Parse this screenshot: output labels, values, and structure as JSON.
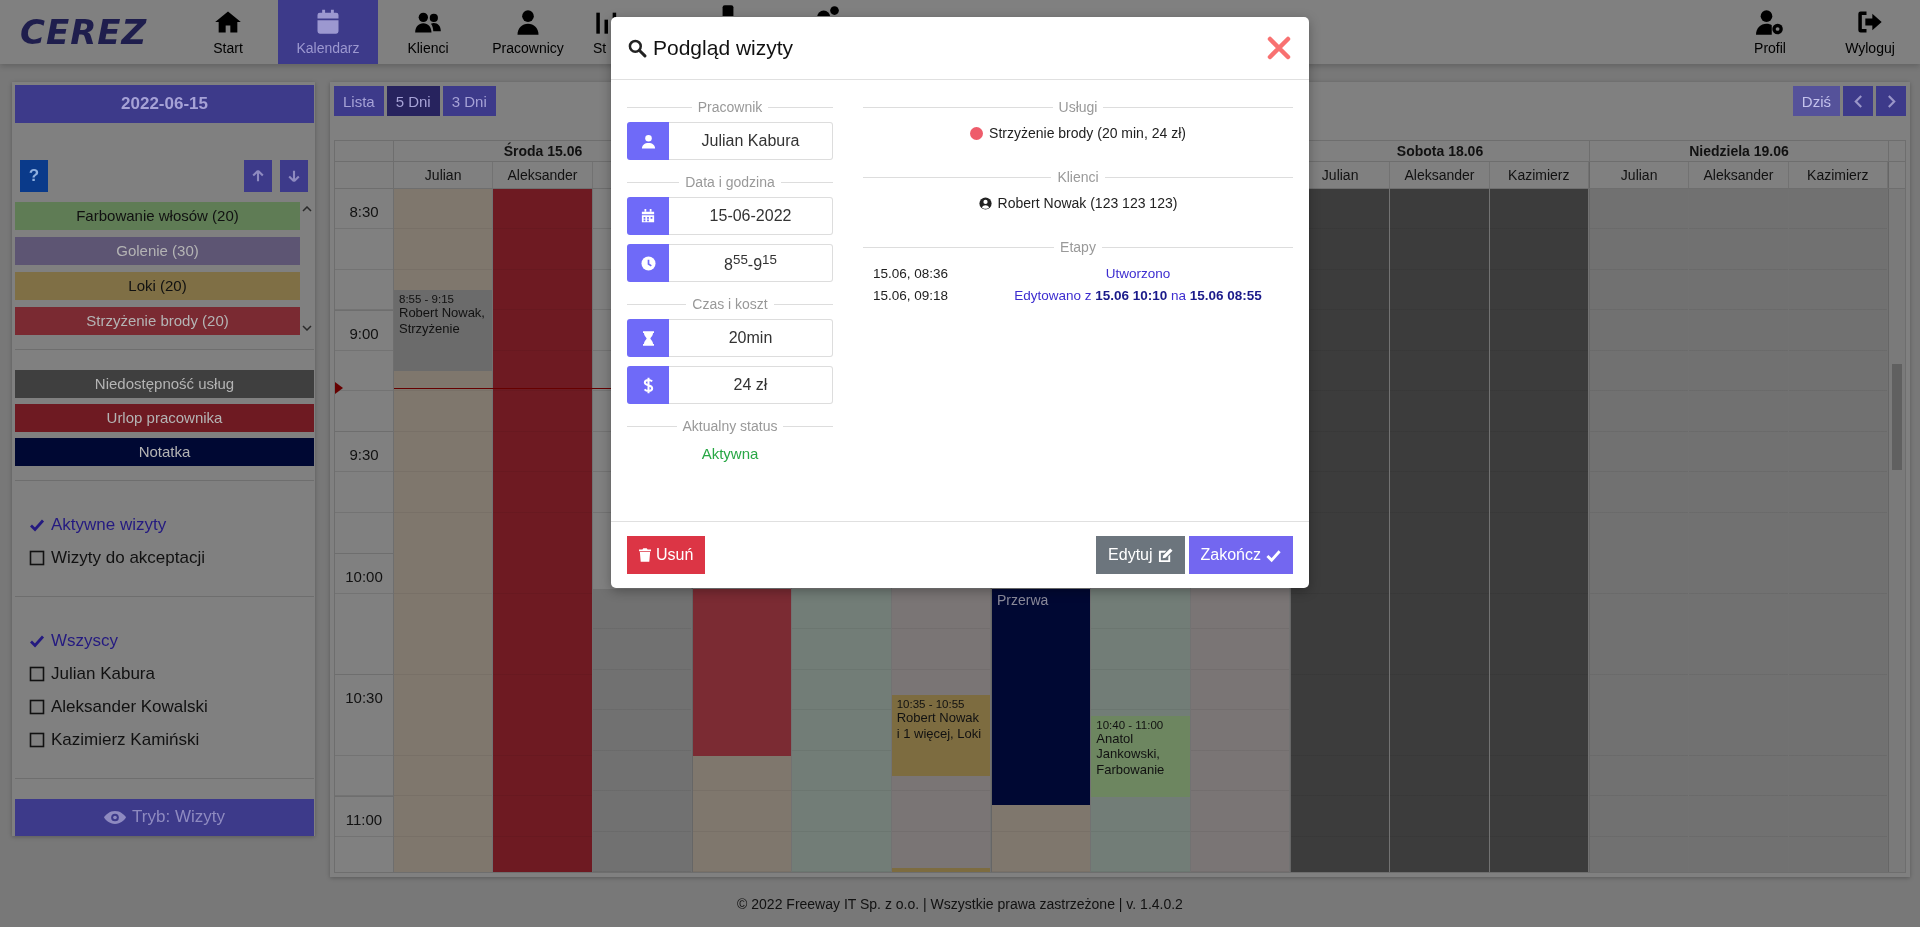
{
  "nav": {
    "logo": "CEREZ",
    "items": [
      {
        "label": "Start",
        "kind": "home",
        "selected": false
      },
      {
        "label": "Kalendarz",
        "kind": "calendar",
        "selected": true
      },
      {
        "label": "Klienci",
        "kind": "users",
        "selected": false
      },
      {
        "label": "Pracownicy",
        "kind": "user",
        "selected": false
      },
      {
        "label": "St",
        "kind": "chart",
        "selected": false
      },
      {
        "kind": "mobile",
        "selected": false
      },
      {
        "kind": "gears",
        "selected": false
      }
    ],
    "right": [
      {
        "label": "Profil",
        "kind": "user-gear"
      },
      {
        "label": "Wyloguj",
        "kind": "logout"
      }
    ]
  },
  "sidebar": {
    "date": "2022-06-15",
    "help": "?",
    "services": [
      {
        "label": "Farbowanie włosów (20)",
        "color": "#5f7c55"
      },
      {
        "label": "Golenie (30)",
        "color": "#5d5573"
      },
      {
        "label": "Loki (20)",
        "color": "#7f6f45"
      },
      {
        "label": "Strzyżenie brody (20)",
        "color": "#7a2a32"
      }
    ],
    "markers": [
      {
        "label": "Niedostępność usług",
        "color": "#3f3f3f"
      },
      {
        "label": "Urlop pracownika",
        "color": "#6e1a22"
      },
      {
        "label": "Notatka",
        "color": "#000833"
      }
    ],
    "status_filters": [
      {
        "label": "Aktywne wizyty",
        "checked": true
      },
      {
        "label": "Wizyty do akceptacji",
        "checked": false
      }
    ],
    "staff_filters": [
      {
        "label": "Wszyscy",
        "checked": true
      },
      {
        "label": "Julian Kabura",
        "checked": false
      },
      {
        "label": "Aleksander Kowalski",
        "checked": false
      },
      {
        "label": "Kazimierz Kamiński",
        "checked": false
      }
    ],
    "mode_button": "Tryb: Wizyty"
  },
  "calendar": {
    "views": [
      {
        "label": "Lista",
        "selected": false
      },
      {
        "label": "5 Dni",
        "selected": true
      },
      {
        "label": "3 Dni",
        "selected": false
      }
    ],
    "today": {
      "label": "Dziś",
      "disabled": true
    },
    "times": [
      "8:30",
      "9:00",
      "9:30",
      "10:00",
      "10:30",
      "11:00"
    ],
    "days": [
      {
        "title": "Środa 15.06",
        "columns": [
          {
            "header": "Julian",
            "kind": "shift",
            "blocks": [
              {
                "kind": "event",
                "color": "#6b6b6b",
                "time": "8:55 - 9:15",
                "text": "Robert Nowak, Strzyżenie"
              }
            ]
          },
          {
            "header": "Aleksander",
            "kind": "leave"
          },
          {
            "kind": "closed"
          }
        ]
      },
      {
        "columns": [
          {
            "kind": "shift",
            "blocks": [
              {
                "kind": "leave",
                "color": "#7b2b33"
              }
            ]
          },
          {
            "kind": "shift"
          },
          {
            "kind": "shift",
            "blocks": [
              {
                "kind": "event",
                "color": "#7d6c40",
                "time": "10:35 - 10:55",
                "text": "Robert Nowak i 1 więcej, Loki"
              },
              {
                "kind": "event",
                "color": "#7d6c40"
              }
            ]
          }
        ]
      },
      {
        "columns": [
          {
            "kind": "shift",
            "blocks": [
              {
                "kind": "break",
                "color": "#000833",
                "text": "Przerwa"
              }
            ]
          },
          {
            "kind": "shift",
            "blocks": [
              {
                "kind": "event",
                "color": "#6d8660",
                "time": "10:40 - 11:00",
                "text": "Anatol Jankowski, Farbowanie"
              }
            ]
          },
          {
            "kind": "shift"
          }
        ]
      },
      {
        "title": "Sobota 18.06",
        "columns": [
          {
            "header": "Julian",
            "kind": "unavailable"
          },
          {
            "header": "Aleksander",
            "kind": "unavailable"
          },
          {
            "header": "Kazimierz",
            "kind": "unavailable"
          }
        ]
      },
      {
        "title": "Niedziela 19.06",
        "columns": [
          {
            "header": "Julian",
            "kind": "closed"
          },
          {
            "header": "Aleksander",
            "kind": "closed"
          },
          {
            "header": "Kazimierz",
            "kind": "closed"
          }
        ]
      }
    ]
  },
  "modal": {
    "title": "Podgląd wizyty",
    "employee": {
      "heading": "Pracownik",
      "value": "Julian Kabura"
    },
    "datetime": {
      "heading": "Data i godzina",
      "date": "15-06-2022",
      "time": "8$^{55}$-9$^{15}$"
    },
    "cost": {
      "heading": "Czas i koszt",
      "duration": "20min",
      "price": "24 zł"
    },
    "status": {
      "heading": "Aktualny status",
      "value": "Aktywna"
    },
    "services": {
      "heading": "Usługi",
      "items": [
        {
          "label": "Strzyżenie brody (20 min, 24 zł)",
          "color": "#ee5c6b"
        }
      ]
    },
    "clients": {
      "heading": "Klienci",
      "items": [
        "Robert Nowak (123 123 123)"
      ]
    },
    "stages": {
      "heading": "Etapy",
      "rows": [
        {
          "date": "15.06, 08:36",
          "text": "Utworzono"
        },
        {
          "date": "15.06, 09:18",
          "text": "Edytowano z **15.06 10:10** na **15.06 08:55**"
        }
      ]
    },
    "buttons": {
      "delete": "Usuń",
      "edit": "Edytuj",
      "finish": "Zakończ"
    }
  },
  "footer": "© 2022 Freeway IT Sp. z o.o. | Wszystkie prawa zastrzeżone | v. 1.4.0.2"
}
